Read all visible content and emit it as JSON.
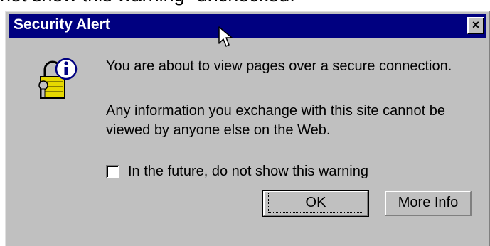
{
  "background_text": "not show this warning\" unchecked.",
  "dialog": {
    "title": "Security Alert",
    "close_label": "×",
    "message_1": "You are about to view pages over a secure connection.",
    "message_2_line_1": "Any information you exchange with this site cannot be",
    "message_2_line_2": "viewed by anyone else on the Web.",
    "checkbox_label": "In the future, do not show this warning",
    "checkbox_checked": false,
    "ok_label": "OK",
    "more_info_label": "More Info"
  },
  "colors": {
    "titlebar": "#000080",
    "face": "#c0c0c0"
  },
  "icons": [
    "lock-info-icon",
    "mouse-cursor-icon",
    "close-icon"
  ]
}
